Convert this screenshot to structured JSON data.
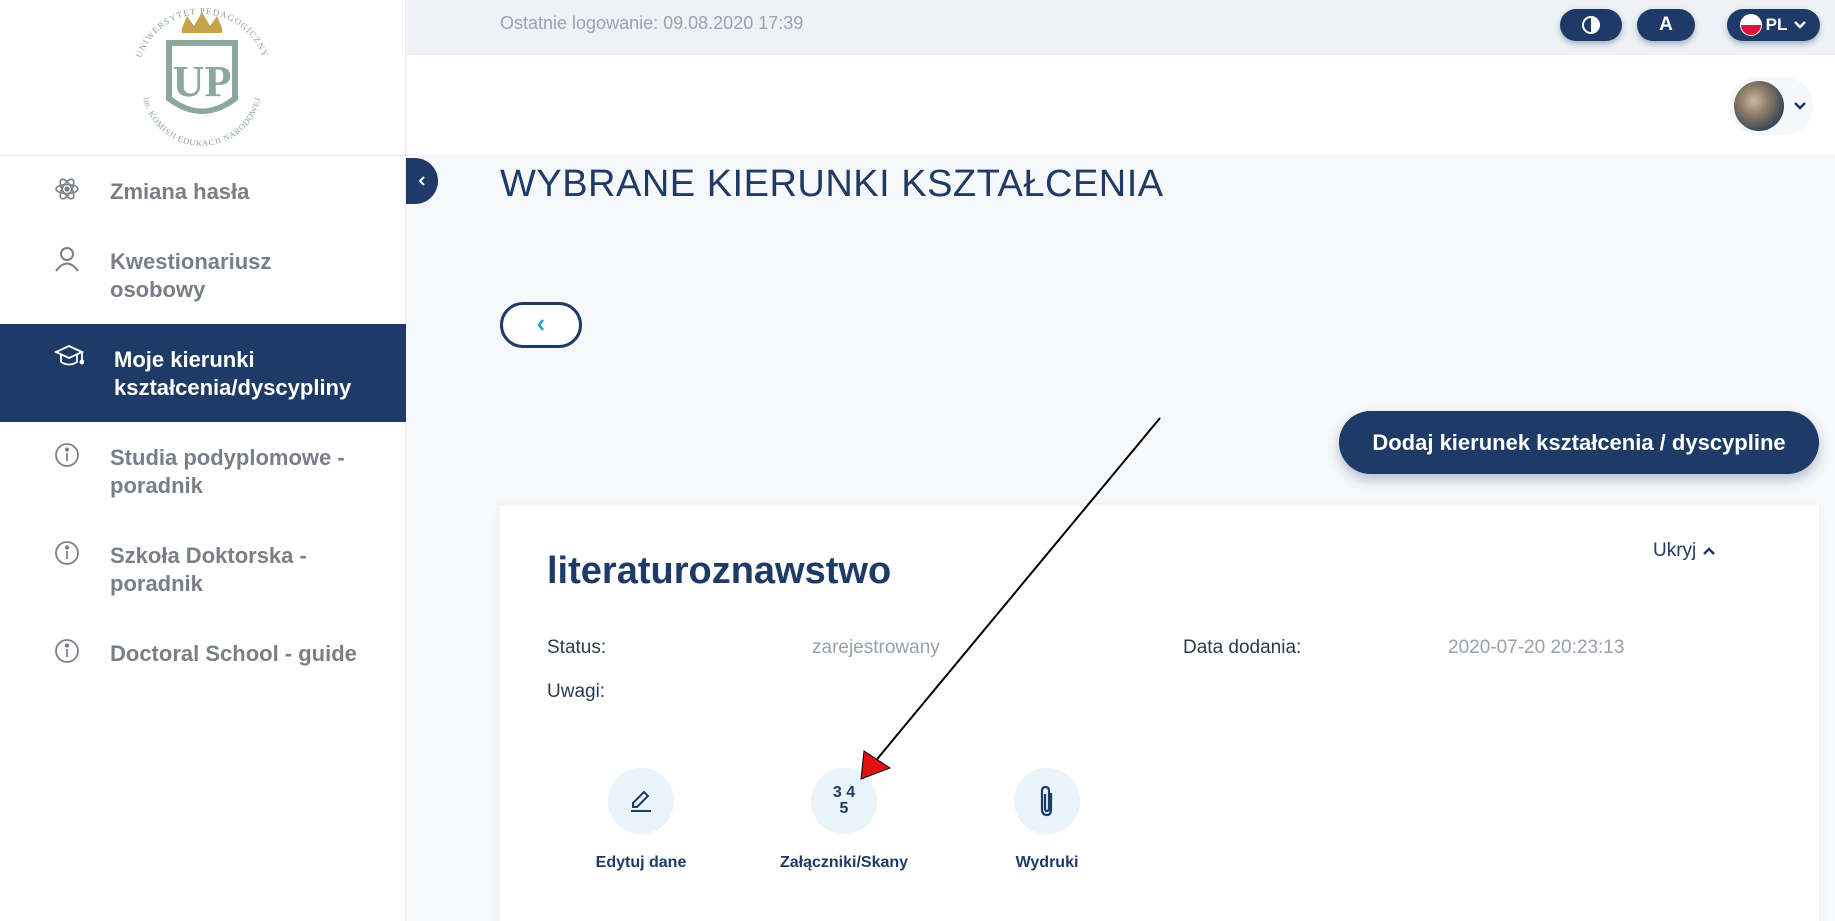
{
  "logo": {
    "ring_text_top": "UNIWERSYTET PEDAGOGICZNY",
    "ring_text_bottom": "im. KOMISJI EDUKACJI NARODOWEJ",
    "letters": "UP"
  },
  "sidebar": {
    "items": [
      {
        "label": "Zmiana hasła",
        "icon": "atom-icon",
        "active": false
      },
      {
        "label": "Kwestionariusz osobowy",
        "icon": "person-icon",
        "active": false
      },
      {
        "label": "Moje kierunki kształcenia/dyscypliny",
        "icon": "graduation-cap-icon",
        "active": true
      },
      {
        "label": "Studia podyplomowe - poradnik",
        "icon": "info-icon",
        "active": false
      },
      {
        "label": "Szkoła Doktorska - poradnik",
        "icon": "info-icon",
        "active": false
      },
      {
        "label": "Doctoral School - guide",
        "icon": "info-icon",
        "active": false
      }
    ]
  },
  "topbar": {
    "last_login_label": "Ostatnie logowanie:",
    "last_login_value": "09.08.2020 17:39",
    "font_button": "A",
    "language": "PL"
  },
  "main": {
    "title": "WYBRANE KIERUNKI KSZTAŁCENIA",
    "add_button": "Dodaj kierunek kształcenia / dyscypline"
  },
  "card": {
    "title": "literaturoznawstwo",
    "toggle_label": "Ukryj",
    "fields": {
      "status_label": "Status:",
      "status_value": "zarejestrowany",
      "date_label": "Data dodania:",
      "date_value": "2020-07-20 20:23:13",
      "notes_label": "Uwagi:"
    },
    "actions": {
      "edit_label": "Edytuj dane",
      "attachments_label": "Załączniki/Skany",
      "attachments_icon_top": "3 4",
      "attachments_icon_bottom": "5",
      "prints_label": "Wydruki"
    }
  },
  "colors": {
    "primary": "#1e3a66",
    "accent_blue": "#1ea0c9",
    "annotation_arrow": "#e01010",
    "logo_green": "#8aa7a0",
    "logo_gold": "#c9a34c"
  }
}
